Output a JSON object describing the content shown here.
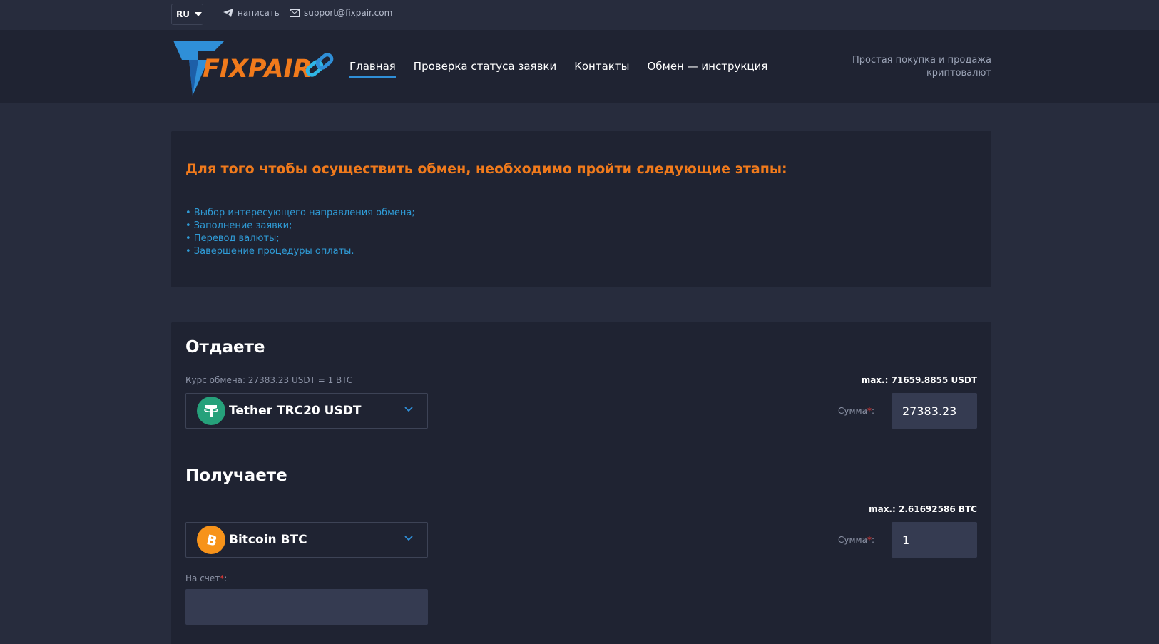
{
  "topbar": {
    "lang": "RU",
    "telegram_label": "написать",
    "email_label": "support@fixpair.com"
  },
  "header": {
    "logo_text": "FIXPAIR",
    "nav": [
      "Главная",
      "Проверка статуса заявки",
      "Контакты",
      "Обмен — инструкция"
    ],
    "tagline_line1": "Простая покупка и продажа",
    "tagline_line2": "криптовалют"
  },
  "steps_card": {
    "title": "Для того чтобы осуществить обмен, необходимо пройти следующие этапы:",
    "steps": [
      "• Выбор интересующего направления обмена;",
      "• Заполнение заявки;",
      "• Перевод валюты;",
      "• Завершение процедуры оплаты."
    ]
  },
  "give": {
    "title": "Отдаете",
    "rate": "Курс обмена: 27383.23 USDT = 1 BTC",
    "max": "max.: 71659.8855 USDT",
    "currency": "Tether TRC20 USDT",
    "sum_label": "Сумма",
    "required_mark": "*",
    "colon": ":",
    "amount": "27383.23"
  },
  "receive": {
    "title": "Получаете",
    "max": "max.: 2.61692586 BTC",
    "currency": "Bitcoin BTC",
    "sum_label": "Сумма",
    "amount": "1",
    "account_label": "На счет",
    "account_value": ""
  },
  "colors": {
    "accent_orange": "#f07a1c",
    "accent_blue": "#2f9bd6",
    "usdt_green": "#26a17b",
    "btc_orange": "#f7931a"
  }
}
